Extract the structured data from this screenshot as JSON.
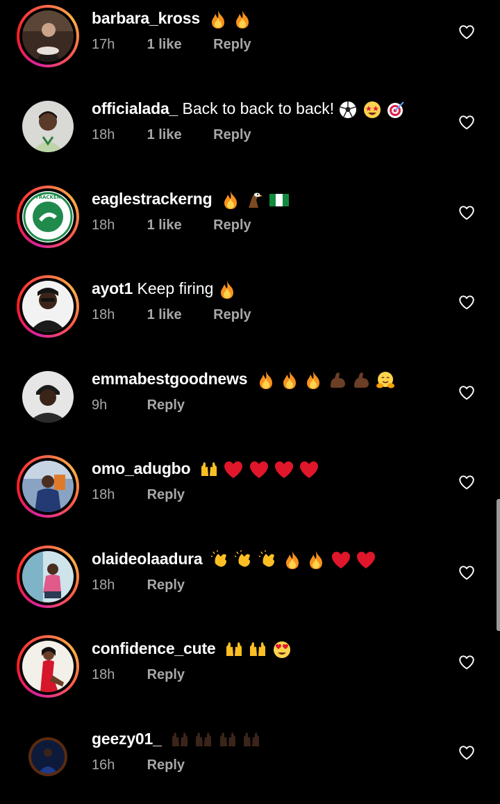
{
  "comments": [
    {
      "username": "barbara_kross",
      "text": "",
      "time": "17h",
      "likes": "1 like",
      "reply": "Reply",
      "emojis": [
        "fire",
        "fire"
      ]
    },
    {
      "username": "officialada_",
      "text": "Back to back to back!",
      "time": "18h",
      "likes": "1 like",
      "reply": "Reply",
      "emojis": [
        "soccer",
        "star-struck",
        "target"
      ]
    },
    {
      "username": "eaglestrackerng",
      "text": "",
      "time": "18h",
      "likes": "1 like",
      "reply": "Reply",
      "emojis": [
        "fire",
        "eagle",
        "nigeria-flag"
      ]
    },
    {
      "username": "ayot1",
      "text": "Keep firing",
      "time": "18h",
      "likes": "1 like",
      "reply": "Reply",
      "emojis": [
        "fire"
      ]
    },
    {
      "username": "emmabestgoodnews",
      "text": "",
      "time": "9h",
      "likes": "",
      "reply": "Reply",
      "emojis": [
        "fire",
        "fire",
        "fire",
        "muscle",
        "muscle",
        "hugging"
      ]
    },
    {
      "username": "omo_adugbo",
      "text": "",
      "time": "18h",
      "likes": "",
      "reply": "Reply",
      "emojis": [
        "raised-hands",
        "heart",
        "heart",
        "heart",
        "heart"
      ]
    },
    {
      "username": "olaideolaadura",
      "text": "",
      "time": "18h",
      "likes": "",
      "reply": "Reply",
      "emojis": [
        "clap",
        "clap",
        "clap",
        "fire",
        "fire",
        "heart",
        "heart"
      ]
    },
    {
      "username": "confidence_cute",
      "text": "",
      "time": "18h",
      "likes": "",
      "reply": "Reply",
      "emojis": [
        "raised-hands",
        "raised-hands",
        "heart-eyes"
      ]
    },
    {
      "username": "geezy01_",
      "text": "",
      "time": "16h",
      "likes": "",
      "reply": "Reply",
      "emojis": [
        "raised-hands-dark",
        "raised-hands-dark",
        "raised-hands-dark",
        "raised-hands-dark"
      ]
    }
  ],
  "colors": {
    "background": "#000000",
    "secondary_text": "#a8a8a8",
    "story_ring": [
      "#d6249f",
      "#fd1d1d",
      "#fcaf45"
    ]
  },
  "icons": {
    "like": "heart-outline-icon"
  }
}
